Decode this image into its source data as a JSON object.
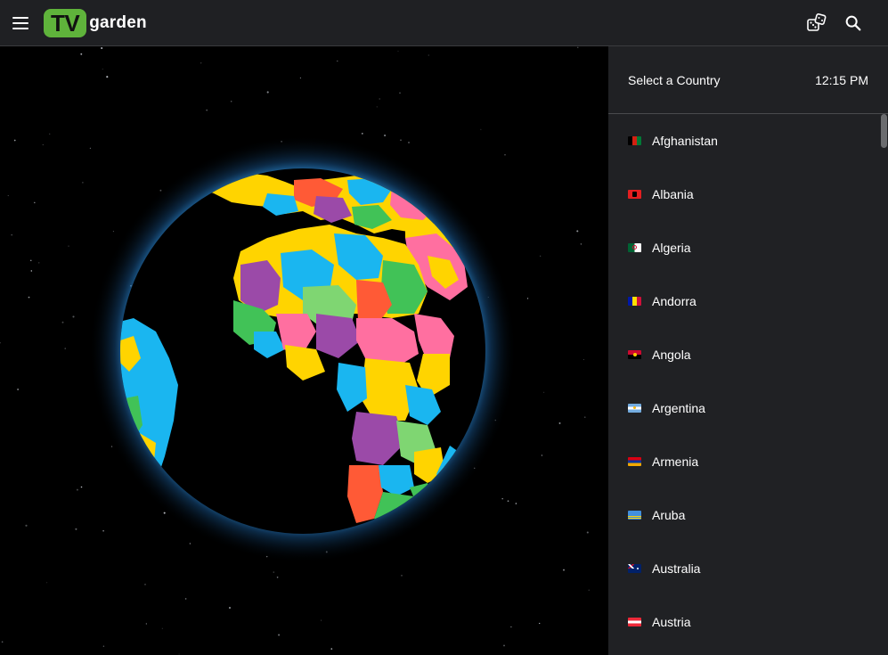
{
  "header": {
    "menu_icon": "hamburger-menu-icon",
    "logo_tv": "TV",
    "logo_garden": "garden",
    "random_icon": "dice-icon",
    "search_icon": "search-icon",
    "bar_color": "#1f2023",
    "logo_green": "#5fb33b"
  },
  "panel": {
    "title": "Select a Country",
    "time": "12:15 PM",
    "background": "#202124"
  },
  "countries": [
    {
      "name": "Afghanistan",
      "flag": "flag-afghanistan-icon"
    },
    {
      "name": "Albania",
      "flag": "flag-albania-icon"
    },
    {
      "name": "Algeria",
      "flag": "flag-algeria-icon"
    },
    {
      "name": "Andorra",
      "flag": "flag-andorra-icon"
    },
    {
      "name": "Angola",
      "flag": "flag-angola-icon"
    },
    {
      "name": "Argentina",
      "flag": "flag-argentina-icon"
    },
    {
      "name": "Armenia",
      "flag": "flag-armenia-icon"
    },
    {
      "name": "Aruba",
      "flag": "flag-aruba-icon"
    },
    {
      "name": "Australia",
      "flag": "flag-australia-icon"
    },
    {
      "name": "Austria",
      "flag": "flag-austria-icon"
    }
  ],
  "globe": {
    "name": "interactive-globe",
    "glow_color": "#2e8fd8"
  }
}
